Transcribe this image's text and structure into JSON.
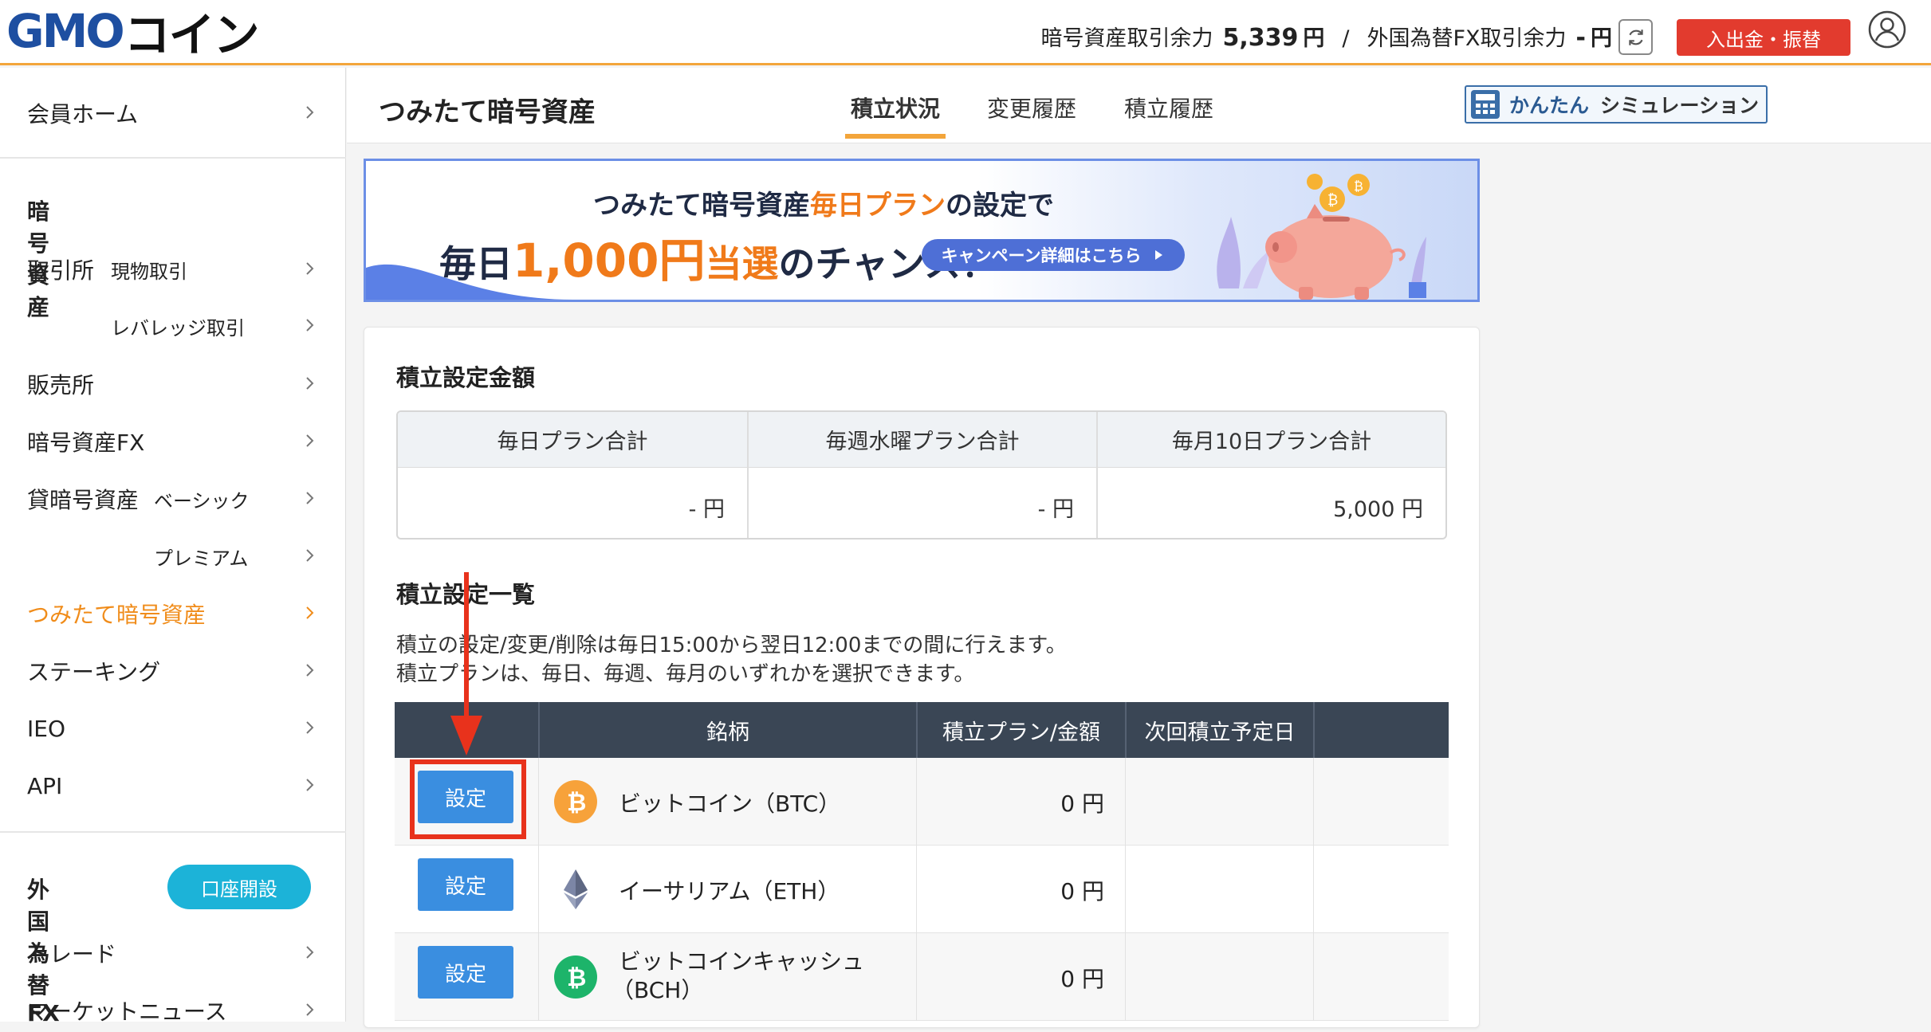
{
  "header": {
    "logo_main": "GMO",
    "logo_kana": "コイン",
    "crypto_balance_label": "暗号資産取引余力",
    "crypto_balance_value": "5,339",
    "crypto_balance_unit": "円",
    "separator": "/",
    "fx_balance_label": "外国為替FX取引余力",
    "fx_balance_value": "-",
    "fx_balance_unit": "円",
    "deposit_label": "入出金・振替"
  },
  "sidebar": {
    "home": "会員ホーム",
    "crypto_heading": "暗号資産",
    "exchange": "取引所",
    "spot": "現物取引",
    "leverage": "レバレッジ取引",
    "sales": "販売所",
    "crypto_fx": "暗号資産FX",
    "lending": "貸暗号資産",
    "basic": "ベーシック",
    "premium": "プレミアム",
    "tsumitate": "つみたて暗号資産",
    "staking": "ステーキング",
    "ieo": "IEO",
    "api": "API",
    "fx_heading": "外国為替FX",
    "open_account": "口座開設",
    "trade": "トレード",
    "market_news": "マーケットニュース"
  },
  "page": {
    "title": "つみたて暗号資産",
    "tabs": [
      "積立状況",
      "変更履歴",
      "積立履歴"
    ],
    "simulation_label_a": "かんたん",
    "simulation_label_b": "シミュレーション"
  },
  "banner": {
    "line1_a": "つみたて暗号資産",
    "line1_hl": "毎日プラン",
    "line1_b": "の設定で",
    "line2_a": "毎日",
    "line2_big": "1,000円",
    "line2_hl": "当選",
    "line2_b": "のチャンス！",
    "cta": "キャンペーン詳細はこちら"
  },
  "summary": {
    "title": "積立設定金額",
    "columns": [
      {
        "label": "毎日プラン合計",
        "value": "- 円"
      },
      {
        "label": "毎週水曜プラン合計",
        "value": "- 円"
      },
      {
        "label": "毎月10日プラン合計",
        "value": "5,000 円"
      }
    ]
  },
  "list": {
    "title": "積立設定一覧",
    "note1": "積立の設定/変更/削除は毎日15:00から翌日12:00までの間に行えます。",
    "note2": "積立プランは、毎日、毎週、毎月のいずれかを選択できます。",
    "headers": [
      "",
      "銘柄",
      "積立プラン/金額",
      "次回積立予定日",
      ""
    ],
    "rows": [
      {
        "button": "設定",
        "name": "ビットコイン（BTC）",
        "amount": "0 円",
        "next": "",
        "icon": "bitcoin-icon"
      },
      {
        "button": "設定",
        "name": "イーサリアム（ETH）",
        "amount": "0 円",
        "next": "",
        "icon": "ethereum-icon"
      },
      {
        "button": "設定",
        "name": "ビットコインキャッシュ",
        "name2": "（BCH）",
        "amount": "0 円",
        "next": "",
        "icon": "bitcoin-cash-icon"
      }
    ]
  },
  "colors": {
    "accent_orange": "#f3a53b",
    "button_blue": "#3a8ee0",
    "header_red": "#e23b2e",
    "annotation_red": "#e8321c",
    "table_head": "#3a4655"
  }
}
